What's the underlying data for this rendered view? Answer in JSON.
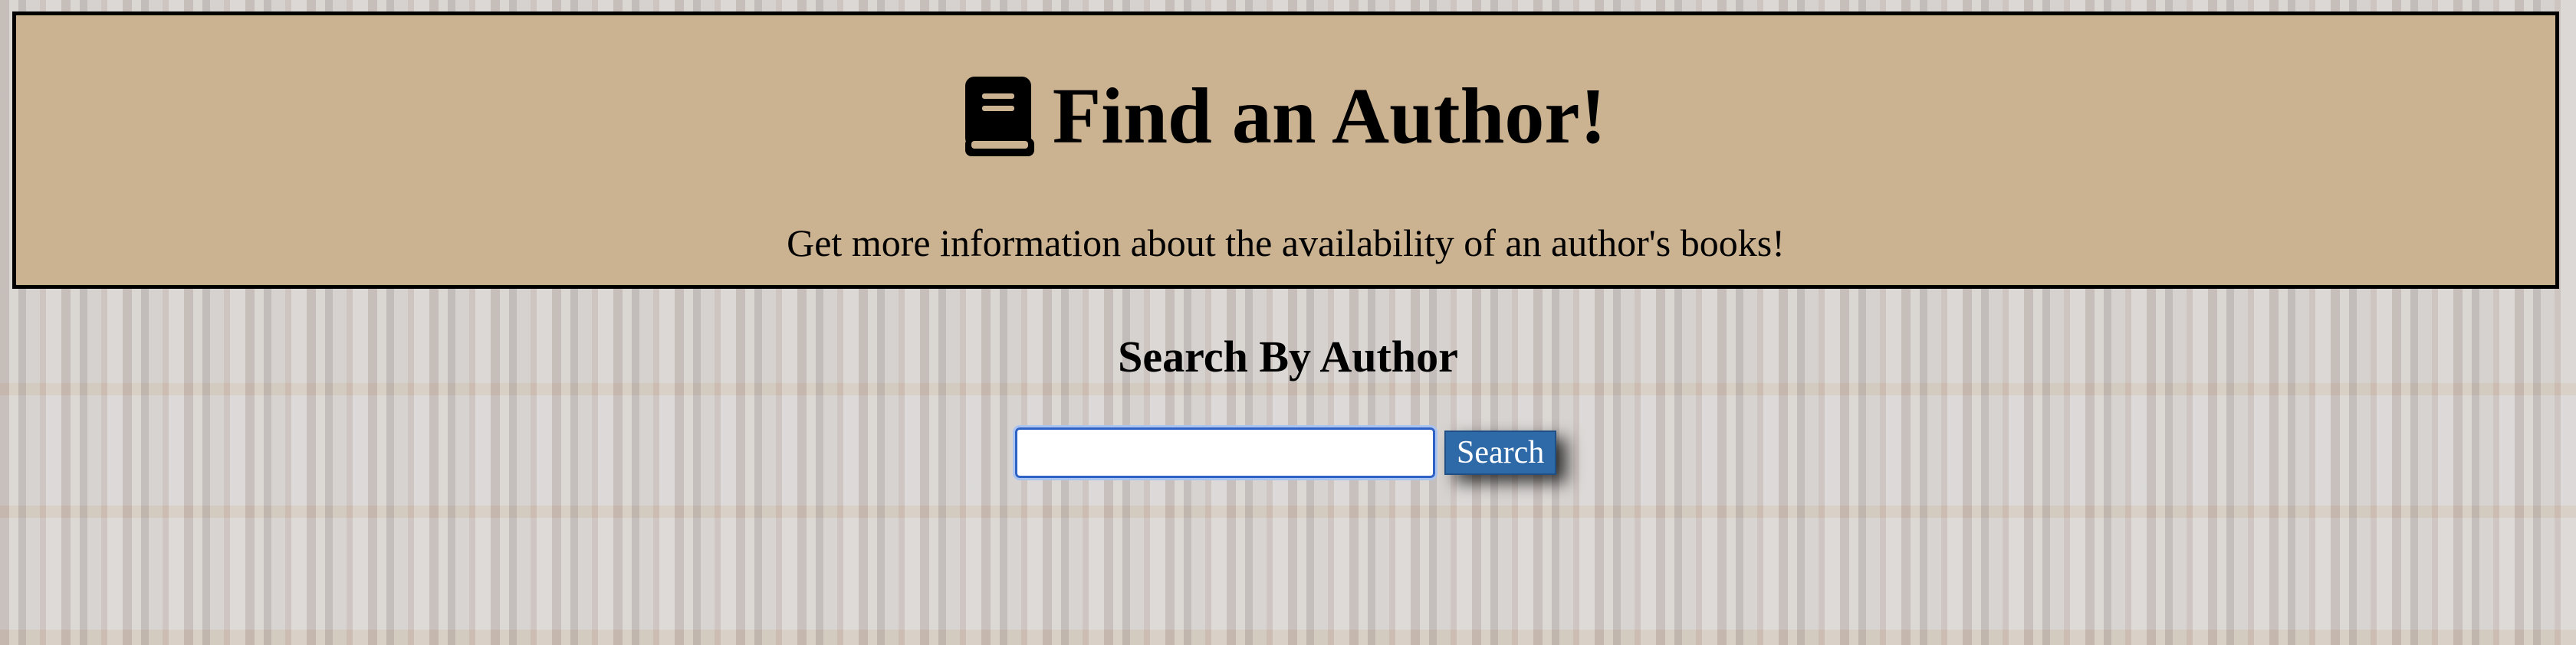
{
  "header": {
    "title": "Find an Author!",
    "subtitle": "Get more information about the availability of an author's books!",
    "icon": "book-icon",
    "background_color": "#cbb290"
  },
  "search": {
    "heading": "Search By Author",
    "input_value": "",
    "button_label": "Search",
    "button_color": "#2f6aa8"
  }
}
